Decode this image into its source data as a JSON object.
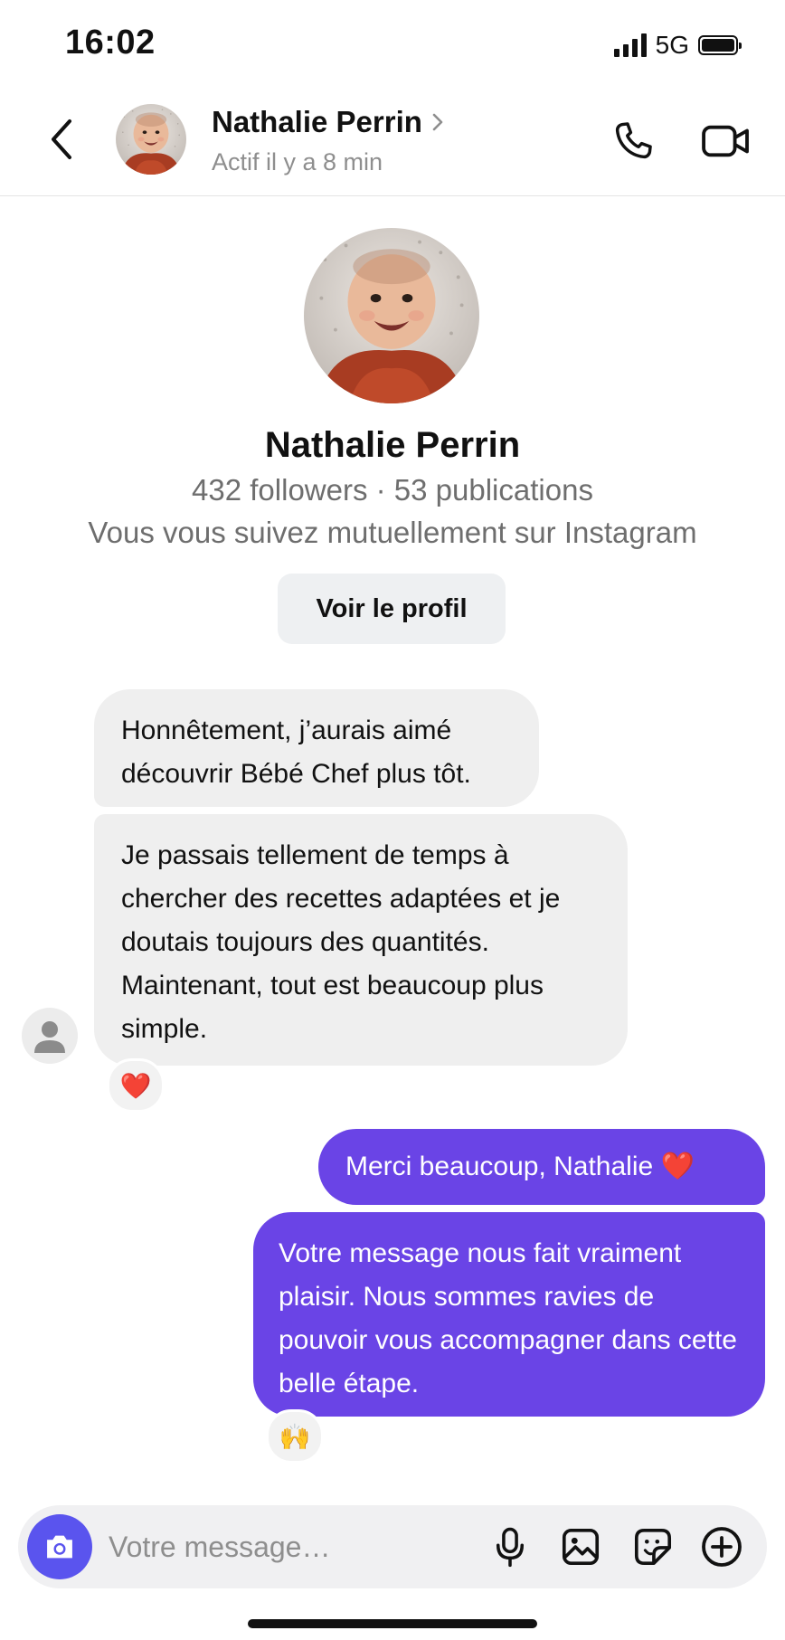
{
  "status_bar": {
    "time": "16:02",
    "network": "5G",
    "icons": [
      "signal-icon",
      "battery-icon"
    ]
  },
  "header": {
    "contact_name": "Nathalie Perrin",
    "activity_status": "Actif il y a 8 min",
    "icons": [
      "chevron-left-icon",
      "chevron-right-icon",
      "phone-icon",
      "video-camera-icon"
    ]
  },
  "profile": {
    "name": "Nathalie Perrin",
    "stats": "432 followers · 53 publications",
    "mutual": "Vous vous suivez mutuellement sur Instagram",
    "view_profile_label": "Voir le profil"
  },
  "messages": [
    {
      "direction": "incoming",
      "text": "Honnêtement, j’aurais aimé découvrir Bébé Chef plus tôt."
    },
    {
      "direction": "incoming",
      "text": "Je passais tellement de temps à chercher des recettes adaptées et je doutais toujours des quantités. Maintenant, tout est beaucoup plus simple.",
      "reaction": "❤️"
    },
    {
      "direction": "outgoing",
      "text": "Merci beaucoup, Nathalie ❤️"
    },
    {
      "direction": "outgoing",
      "text": "Votre message nous fait vraiment plaisir. Nous sommes ravies de pouvoir vous accompagner dans cette belle étape.",
      "reaction": "🙌"
    }
  ],
  "composer": {
    "placeholder": "Votre message…",
    "value": "",
    "icons": [
      "camera-icon",
      "microphone-icon",
      "image-icon",
      "sticker-icon",
      "plus-circle-icon"
    ]
  },
  "colors": {
    "outgoing_bubble": "#6a44e6",
    "incoming_bubble": "#efefef",
    "camera_button": "#5a54ee",
    "secondary_text": "#8e8e8e"
  }
}
